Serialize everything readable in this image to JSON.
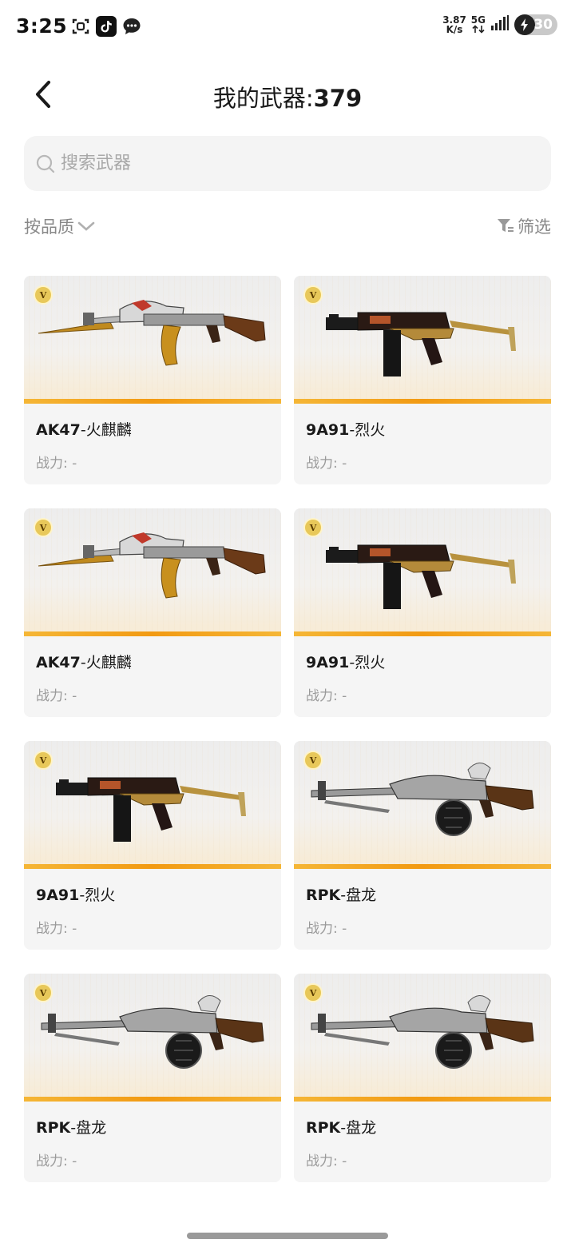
{
  "status_bar": {
    "time": "3:25",
    "net_speed_value": "3.87",
    "net_speed_unit": "K/s",
    "network": "5G",
    "battery": "30"
  },
  "header": {
    "title_prefix": "我的武器:",
    "title_count": "379"
  },
  "search": {
    "placeholder": "搜索武器"
  },
  "filters": {
    "sort_label": "按品质",
    "filter_label": "筛选"
  },
  "badge_letter": "V",
  "power_label": "战力: -",
  "weapons": [
    {
      "name_code": "AK47",
      "name_skin": "-火麒麟",
      "icon": "ak47-gun-icon"
    },
    {
      "name_code": "9A91",
      "name_skin": "-烈火",
      "icon": "smg-gun-icon"
    },
    {
      "name_code": "AK47",
      "name_skin": "-火麒麟",
      "icon": "ak47-gun-icon"
    },
    {
      "name_code": "9A91",
      "name_skin": "-烈火",
      "icon": "smg-gun-icon"
    },
    {
      "name_code": "9A91",
      "name_skin": "-烈火",
      "icon": "smg-gun-icon"
    },
    {
      "name_code": "RPK",
      "name_skin": "-盘龙",
      "icon": "rpk-gun-icon"
    },
    {
      "name_code": "RPK",
      "name_skin": "-盘龙",
      "icon": "rpk-gun-icon"
    },
    {
      "name_code": "RPK",
      "name_skin": "-盘龙",
      "icon": "rpk-gun-icon"
    }
  ],
  "colors": {
    "accent_stripe": "#f29a12",
    "card_bg": "#f5f5f5",
    "muted_text": "#9a9a9a"
  }
}
